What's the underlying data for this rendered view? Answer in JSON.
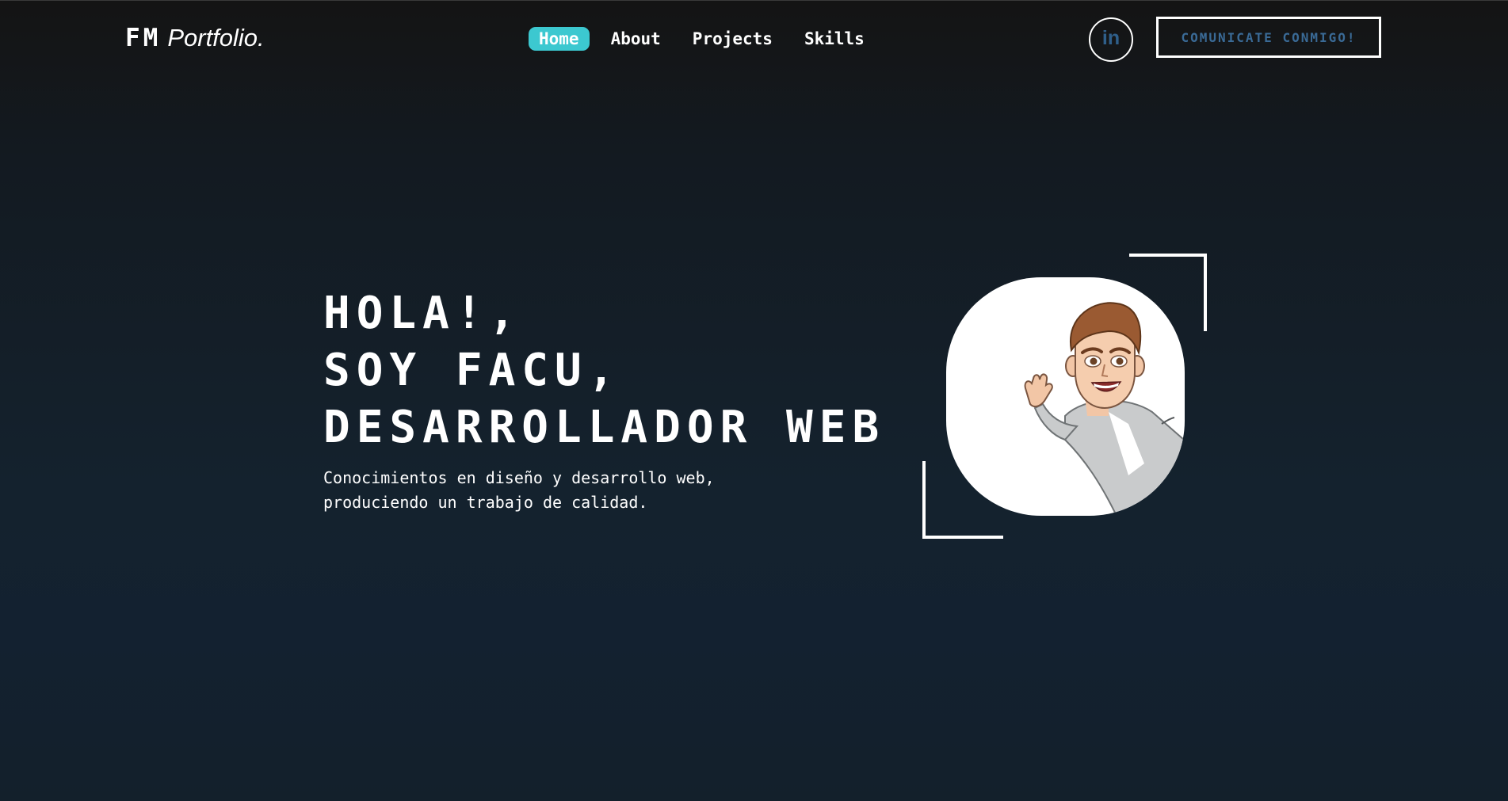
{
  "header": {
    "logo_mark": "FM",
    "logo_text": "Portfolio.",
    "nav": [
      {
        "label": "Home",
        "active": true
      },
      {
        "label": "About",
        "active": false
      },
      {
        "label": "Projects",
        "active": false
      },
      {
        "label": "Skills",
        "active": false
      }
    ],
    "linkedin_icon": "linkedin-icon",
    "linkedin_glyph": "in",
    "contact_label": "COMUNICATE CONMIGO!"
  },
  "hero": {
    "title_lines": [
      "HOLA!,",
      "SOY FACU,",
      "DESARROLLADOR WEB"
    ],
    "description": "Conocimientos en diseño y desarrollo web, produciendo un trabajo de calidad.",
    "avatar_icon": "waving-character-avatar"
  },
  "colors": {
    "accent": "#3cc8d0",
    "button_text": "#3a6a96",
    "background_top": "#141414",
    "background_bottom": "#13202b"
  }
}
